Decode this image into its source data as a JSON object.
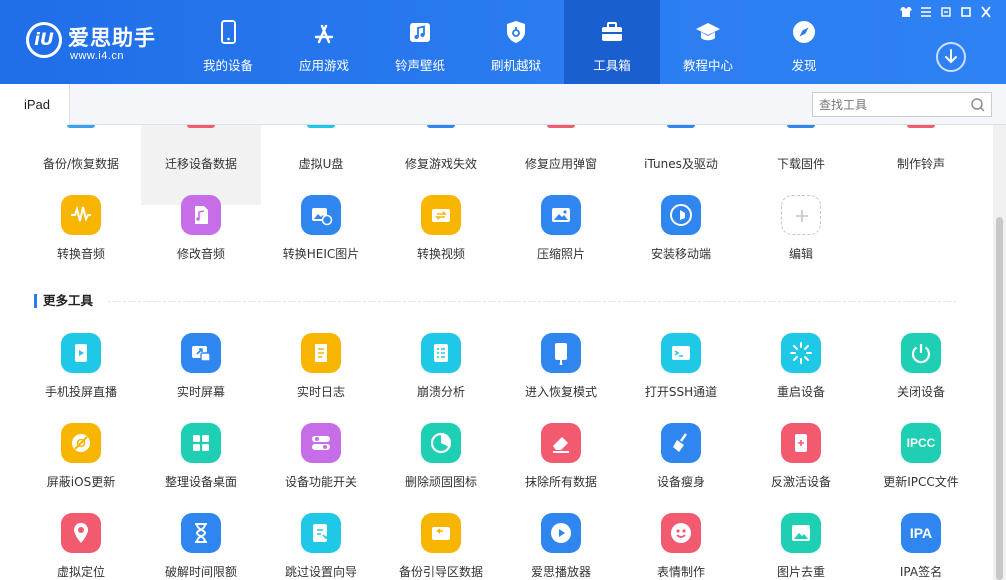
{
  "brand": {
    "name": "爱思助手",
    "url": "www.i4.cn",
    "logo_mark": "iU"
  },
  "nav": [
    {
      "label": "我的设备",
      "icon": "phone-icon"
    },
    {
      "label": "应用游戏",
      "icon": "appstore-icon"
    },
    {
      "label": "铃声壁纸",
      "icon": "music-icon"
    },
    {
      "label": "刷机越狱",
      "icon": "shield-icon"
    },
    {
      "label": "工具箱",
      "icon": "toolbox-icon",
      "active": true
    },
    {
      "label": "教程中心",
      "icon": "graduation-cap-icon"
    },
    {
      "label": "发现",
      "icon": "compass-icon"
    }
  ],
  "window_controls": [
    "shirt-icon",
    "list-icon",
    "minimize-icon",
    "maximize-icon",
    "close-icon"
  ],
  "device_tab": "iPad",
  "search": {
    "placeholder": "查找工具",
    "value": ""
  },
  "top_row": [
    "备份/恢复数据",
    "迁移设备数据",
    "虚拟U盘",
    "修复游戏失效",
    "修复应用弹窗",
    "iTunes及驱动",
    "下载固件",
    "制作铃声"
  ],
  "my_tools": [
    {
      "label": "转换音频",
      "icon": "audio-wave-icon",
      "color": "#f7b500"
    },
    {
      "label": "修改音频",
      "icon": "music-file-icon",
      "color": "#c86de8"
    },
    {
      "label": "转换HEIC图片",
      "icon": "image-convert-icon",
      "color": "#2f86ee"
    },
    {
      "label": "转换视频",
      "icon": "video-convert-icon",
      "color": "#f7b500"
    },
    {
      "label": "压缩照片",
      "icon": "photo-icon",
      "color": "#2f86ee"
    },
    {
      "label": "安装移动端",
      "icon": "i4-app-icon",
      "color": "#2f86ee"
    },
    {
      "label": "编辑",
      "icon": "plus-icon",
      "color": "#ffffff"
    }
  ],
  "more_section": {
    "title": "更多工具"
  },
  "more_tools": [
    {
      "label": "手机投屏直播",
      "icon": "screen-cast-icon",
      "color": "#1ec8e6"
    },
    {
      "label": "实时屏幕",
      "icon": "realtime-screen-icon",
      "color": "#2f86ee"
    },
    {
      "label": "实时日志",
      "icon": "log-icon",
      "color": "#f7b500"
    },
    {
      "label": "崩溃分析",
      "icon": "crash-report-icon",
      "color": "#1ec8e6"
    },
    {
      "label": "进入恢复模式",
      "icon": "recovery-icon",
      "color": "#2f86ee"
    },
    {
      "label": "打开SSH通道",
      "icon": "ssh-terminal-icon",
      "color": "#1ec8e6"
    },
    {
      "label": "重启设备",
      "icon": "restart-icon",
      "color": "#1ec8e6"
    },
    {
      "label": "关闭设备",
      "icon": "power-icon",
      "color": "#1ecfb3"
    },
    {
      "label": "屏蔽iOS更新",
      "icon": "block-update-icon",
      "color": "#f7b500"
    },
    {
      "label": "整理设备桌面",
      "icon": "grid-icon",
      "color": "#1ecfb3"
    },
    {
      "label": "设备功能开关",
      "icon": "toggle-icon",
      "color": "#c86de8"
    },
    {
      "label": "删除顽固图标",
      "icon": "pie-icon",
      "color": "#1ecfb3"
    },
    {
      "label": "抹除所有数据",
      "icon": "eraser-icon",
      "color": "#f25a70"
    },
    {
      "label": "设备瘦身",
      "icon": "broom-icon",
      "color": "#2f86ee"
    },
    {
      "label": "反激活设备",
      "icon": "deactivate-icon",
      "color": "#f25a70"
    },
    {
      "label": "更新IPCC文件",
      "icon": "ipcc-icon",
      "color": "#1ecfb3",
      "text": "IPCC"
    },
    {
      "label": "虚拟定位",
      "icon": "location-pin-icon",
      "color": "#f25a70"
    },
    {
      "label": "破解时间限额",
      "icon": "hourglass-icon",
      "color": "#2f86ee"
    },
    {
      "label": "跳过设置向导",
      "icon": "skip-wizard-icon",
      "color": "#1ec8e6"
    },
    {
      "label": "备份引导区数据",
      "icon": "backup-boot-icon",
      "color": "#f7b500"
    },
    {
      "label": "爱思播放器",
      "icon": "play-icon",
      "color": "#2f86ee"
    },
    {
      "label": "表情制作",
      "icon": "emoji-icon",
      "color": "#f25a70"
    },
    {
      "label": "图片去重",
      "icon": "image-dedupe-icon",
      "color": "#1ecfb3"
    },
    {
      "label": "IPA签名",
      "icon": "ipa-sign-icon",
      "color": "#2f86ee",
      "text": "IPA"
    }
  ]
}
